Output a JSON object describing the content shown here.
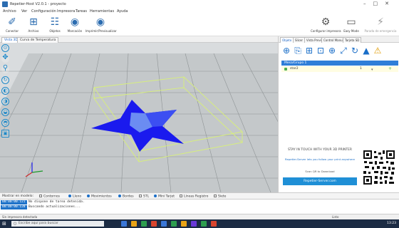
{
  "window": {
    "title": "Repetier-Host V2.0.1 - proyecto",
    "controls": [
      "–",
      "□",
      "✕"
    ]
  },
  "menu": [
    "Archivo",
    "Ver",
    "Configuración",
    "Impresora",
    "Tareas",
    "Herramientas",
    "Ayuda"
  ],
  "toolbar": {
    "items": [
      {
        "label": "Conectar",
        "icon": "plug-icon"
      },
      {
        "label": "Archivo",
        "icon": "load-file-icon"
      },
      {
        "label": "Objetos",
        "icon": "objects-icon"
      },
      {
        "label": "Marcación",
        "icon": "eye-icon"
      },
      {
        "label": "Imprimir/Previsualizar",
        "icon": "preview-eye-icon"
      }
    ],
    "right_items": [
      {
        "label": "Configurar impresora",
        "icon": "printer-settings-icon"
      },
      {
        "label": "Easy Mode",
        "icon": "easy-mode-icon"
      },
      {
        "label": "Parada de emergencia",
        "icon": "emergency-stop-icon"
      }
    ]
  },
  "doc_tabs": [
    "Vista 3D",
    "Curva de Temperatura"
  ],
  "view_tools": [
    "target-icon",
    "move-icon",
    "zoom-icon",
    "rotate-icon",
    "front-view-icon",
    "top-view-icon",
    "side-view-icon",
    "iso-view-icon",
    "cube-icon"
  ],
  "right_tabs": [
    "Objeto",
    "Slicer",
    "Vista Previa",
    "Control Manual",
    "Tarjeta SD"
  ],
  "right_icons": [
    "add-object-icon",
    "copy-icon",
    "autoplace-icon",
    "grid-icon",
    "center-icon",
    "scale-icon",
    "rotate-object-icon",
    "mirror-icon",
    "warning-icon"
  ],
  "object_list": {
    "sheet": "Mesa/Grupo 1",
    "rows": [
      {
        "name": "star2",
        "count": "1"
      }
    ]
  },
  "promo": {
    "headline": "STAY IN TOUCH WITH YOUR 3D PRINTER",
    "subline": "Repetier-Server lets you follow your print anywhere",
    "scan": "Scan QR to Download",
    "cta": "Repetier-Server.com"
  },
  "legend": [
    {
      "label": "Mostrar en modelo:",
      "kind": "text"
    },
    {
      "label": "Contornos",
      "kind": "box"
    },
    {
      "label": "Lleno",
      "kind": "dot"
    },
    {
      "label": "Movimientos",
      "kind": "dot"
    },
    {
      "label": "Bordes",
      "kind": "dot"
    },
    {
      "label": "STL",
      "kind": "box"
    },
    {
      "label": "Mini Tarjet",
      "kind": "dot"
    },
    {
      "label": "Líneas Registro",
      "kind": "box"
    },
    {
      "label": "Siete",
      "kind": "box"
    }
  ],
  "log": [
    {
      "time": "00:00:00.121",
      "message": "No dispone de tarea detenida."
    },
    {
      "time": "00:00:00.128",
      "message": "Buscando actualizaciones..."
    }
  ],
  "status": {
    "left": "Sin impresora detectada",
    "right": "Listo"
  },
  "taskbar": {
    "search_placeholder": "Escribe aquí para buscar",
    "time": "13:23",
    "app_colors": [
      "#3a77d8",
      "#e8a317",
      "#2e9e4f",
      "#d8452e",
      "#3a77d8",
      "#2e9e4f",
      "#e8a317",
      "#6a3ad8",
      "#2e9e4f",
      "#d8452e"
    ]
  },
  "colors": {
    "accent": "#1f73c9",
    "star": "#1a1aee",
    "star_highlight": "#4d6cf0",
    "bed": "#c2c6c8"
  }
}
